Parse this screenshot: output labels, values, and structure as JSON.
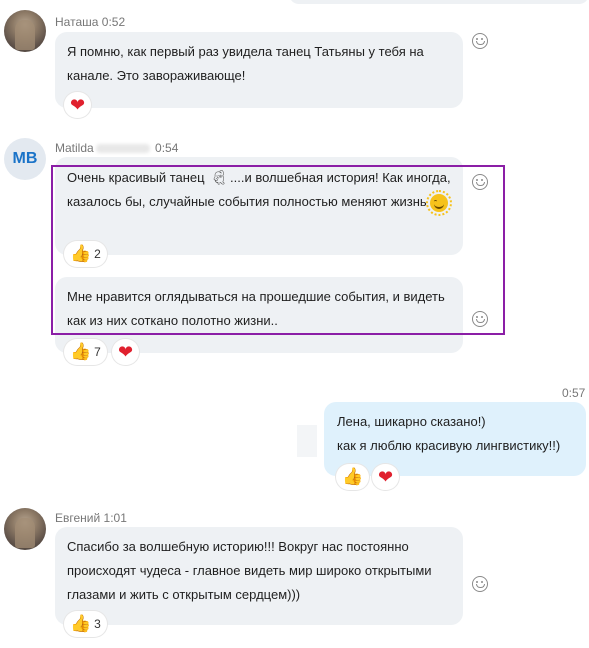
{
  "messages": {
    "m1": {
      "sender": "Наташа",
      "time": "0:52",
      "text": "Я помню, как первый раз увидела танец Татьяны у тебя на канале. Это завораживающе!"
    },
    "m2": {
      "sender": "Matilda",
      "initials": "MB",
      "time": "0:54",
      "text_a": "Очень красивый танец",
      "text_b": "....и волшебная история! Как иногда, казалось бы, случайные события полностью меняют жизнь",
      "like_count": "2"
    },
    "m3": {
      "text": "Мне нравится оглядываться на прошедшие события, и видеть как из них соткано полотно жизни..",
      "like_count": "7"
    },
    "m4": {
      "time": "0:57",
      "line1": "Лена, шикарно сказано!)",
      "line2": "как я люблю красивую лингвистику!!)"
    },
    "m5": {
      "sender": "Евгений",
      "time": "1:01",
      "text": "Спасибо за волшебную историю!!! Вокруг нас постоянно происходят чудеса - главное видеть мир широко открытыми глазами и жить с открытым сердцем)))",
      "like_count": "3"
    }
  },
  "icons": {
    "like": "thumbs-up-emoji",
    "heart": "red-heart-emoji",
    "add_reaction": "smiley-outline-icon"
  },
  "colors": {
    "incoming_bubble": "#eef1f4",
    "outgoing_bubble": "#dff1fc",
    "highlight_border": "#8b1ea6",
    "initials_avatar": "#1a73c8"
  }
}
